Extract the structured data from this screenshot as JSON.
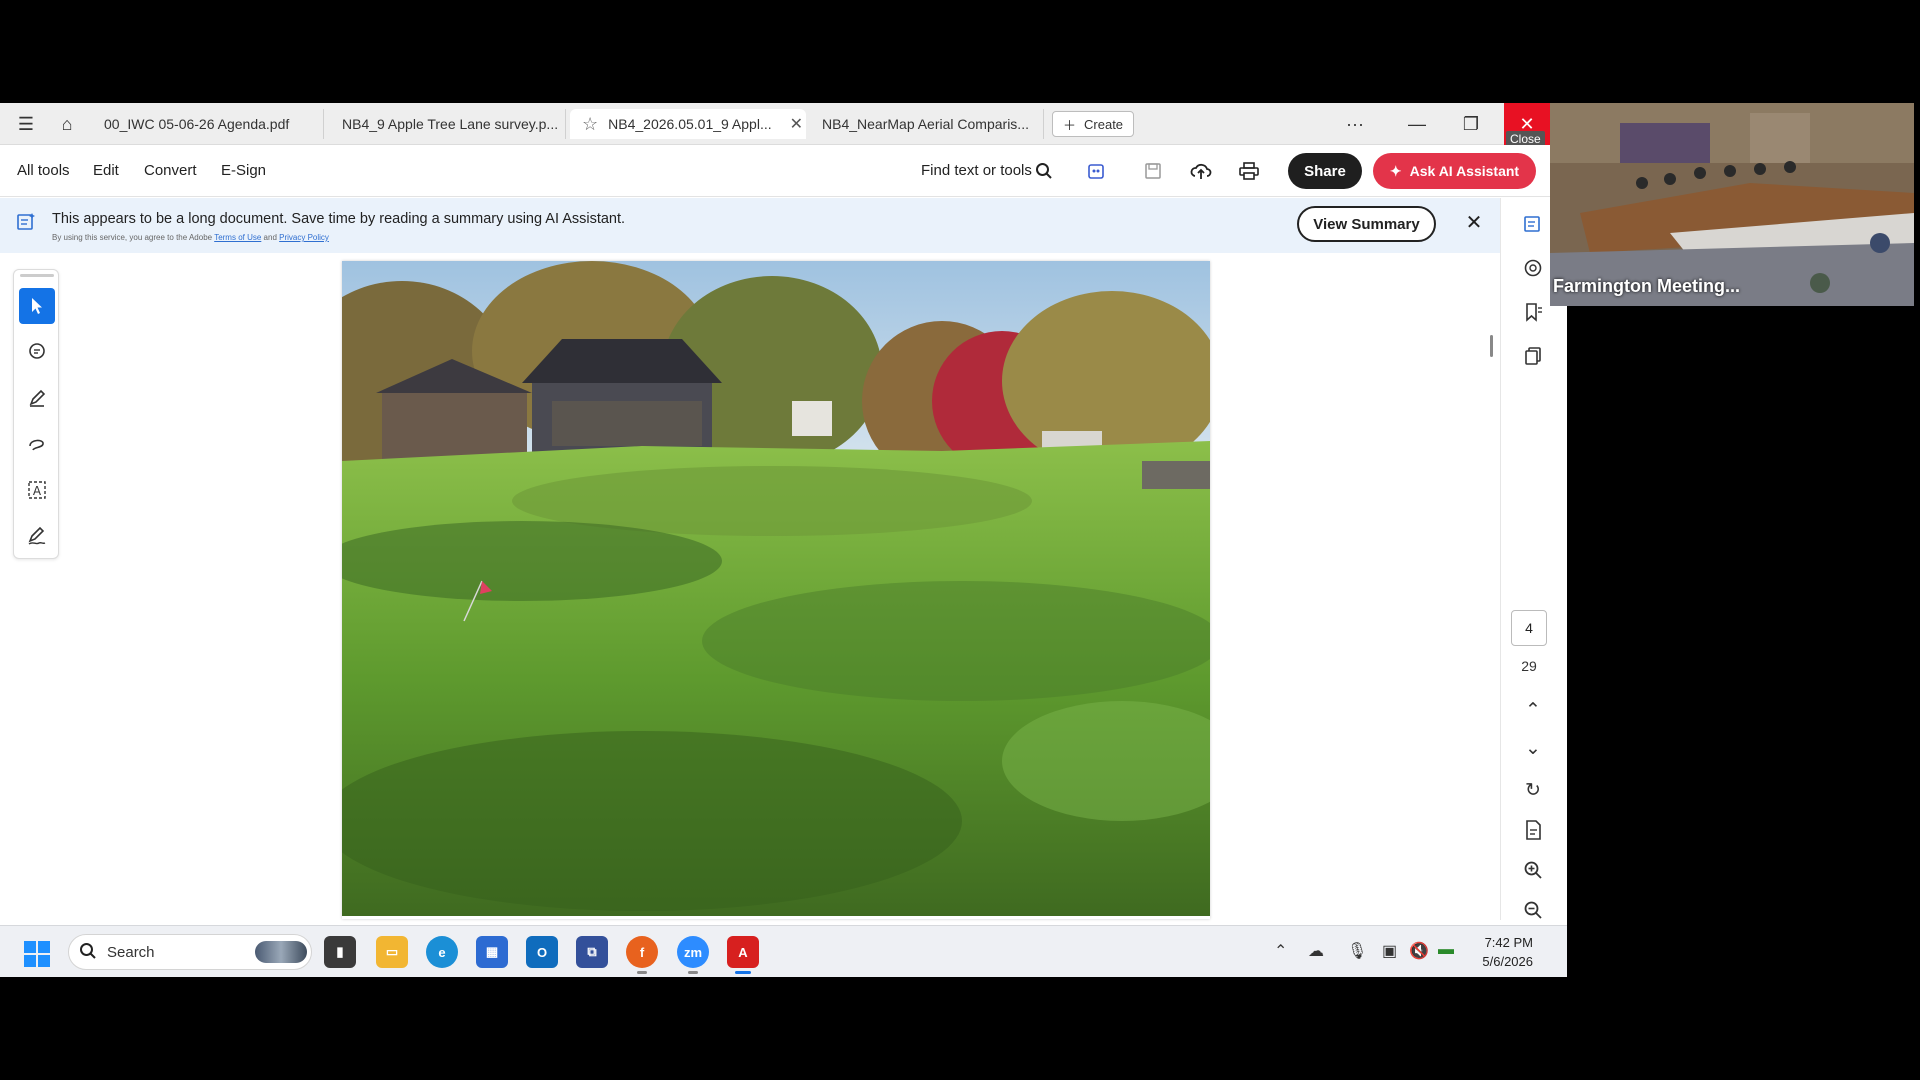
{
  "tabbar": {
    "tabs": [
      {
        "label": "00_IWC 05-06-26 Agenda.pdf",
        "active": false
      },
      {
        "label": "NB4_9 Apple Tree Lane survey.p...",
        "active": false
      },
      {
        "label": "NB4_2026.05.01_9 Appl...",
        "active": true
      },
      {
        "label": "NB4_NearMap Aerial Comparis...",
        "active": false
      }
    ],
    "create_label": "Create",
    "more_label": "···",
    "close_tooltip": "Close"
  },
  "toolbar": {
    "menu": [
      "All tools",
      "Edit",
      "Convert",
      "E-Sign"
    ],
    "find_label": "Find text or tools",
    "share_label": "Share",
    "ai_label": "Ask AI Assistant"
  },
  "banner": {
    "text": "This appears to be a long document. Save time by reading a summary using AI Assistant.",
    "fine_print_prefix": "By using this service, you agree to the Adobe",
    "terms_label": "Terms of Use",
    "and_label": "and",
    "privacy_label": "Privacy Policy",
    "view_summary_label": "View Summary"
  },
  "navigation": {
    "current_page": "4",
    "total_pages": "29"
  },
  "taskbar": {
    "search_label": "Search",
    "time": "7:42 PM",
    "date": "5/6/2026"
  },
  "video": {
    "label": "Farmington Meeting..."
  },
  "colors": {
    "accent_blue": "#1473e6",
    "ai_button": "#e3344a",
    "close_red": "#e81123",
    "banner_bg": "#eaf2fb"
  }
}
